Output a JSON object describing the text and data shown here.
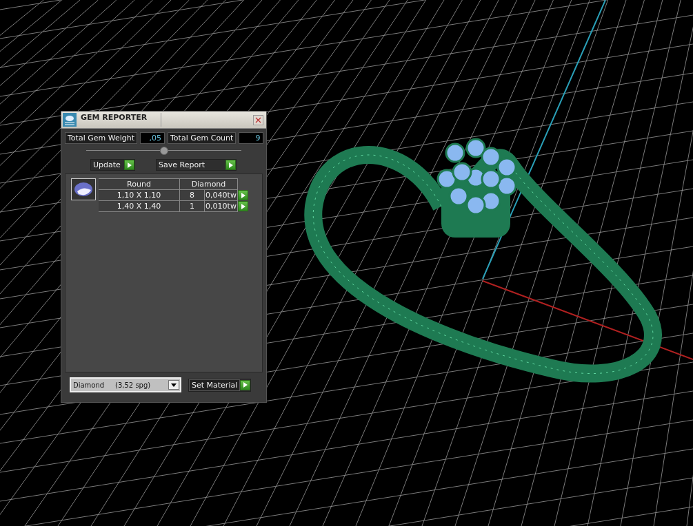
{
  "window": {
    "title": "GEM REPORTER"
  },
  "totals": [
    {
      "label": "Total Gem Weight",
      "value": ",05"
    },
    {
      "label": "Total Gem Count",
      "value": "9"
    }
  ],
  "buttons": [
    "Update",
    "Save Report"
  ],
  "table": {
    "columns": [
      "Round",
      "Diamond"
    ],
    "rows": [
      {
        "size": "1,10 X 1,10",
        "count": "8",
        "weight": "0,040tw"
      },
      {
        "size": "1,40 X 1,40",
        "count": "1",
        "weight": "0,010tw"
      }
    ]
  },
  "material": {
    "value": "Diamond     (3,52 spg)",
    "button": "Set Material"
  }
}
